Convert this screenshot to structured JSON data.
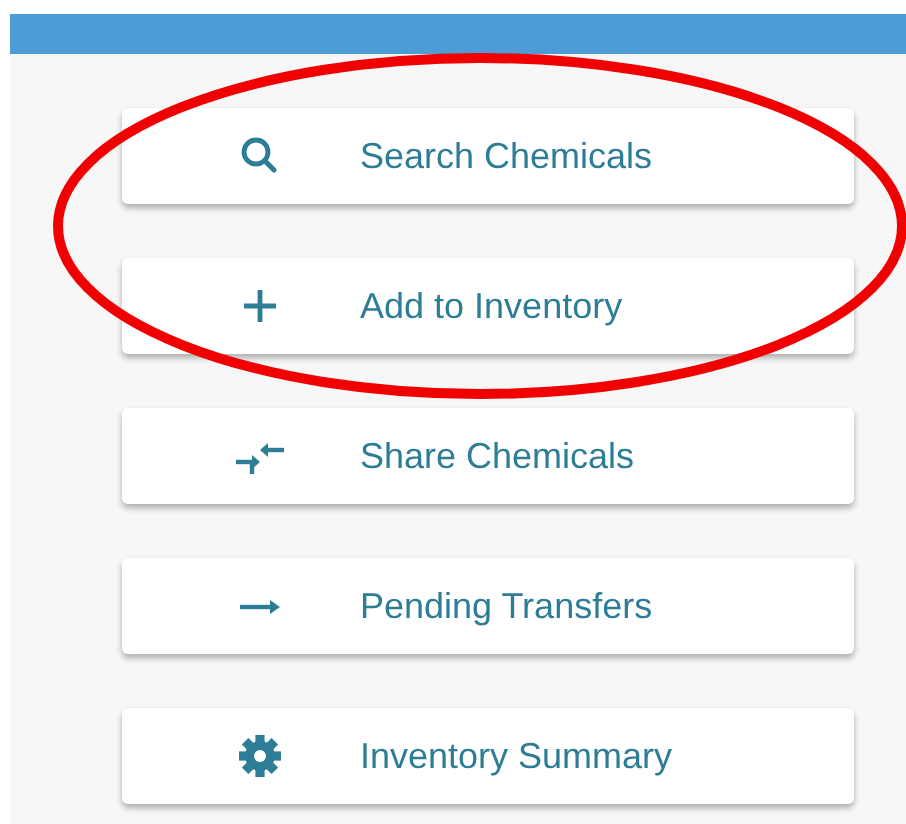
{
  "header_bar": {
    "shown": true
  },
  "menu": [
    {
      "label": "Search Chemicals",
      "kind": "search"
    },
    {
      "label": "Add to Inventory",
      "kind": "add"
    },
    {
      "label": "Share Chemicals",
      "kind": "share"
    },
    {
      "label": "Pending Transfers",
      "kind": "arrow"
    },
    {
      "label": "Inventory Summary",
      "kind": "gear"
    }
  ],
  "annotation": {
    "kind": "ellipse"
  }
}
